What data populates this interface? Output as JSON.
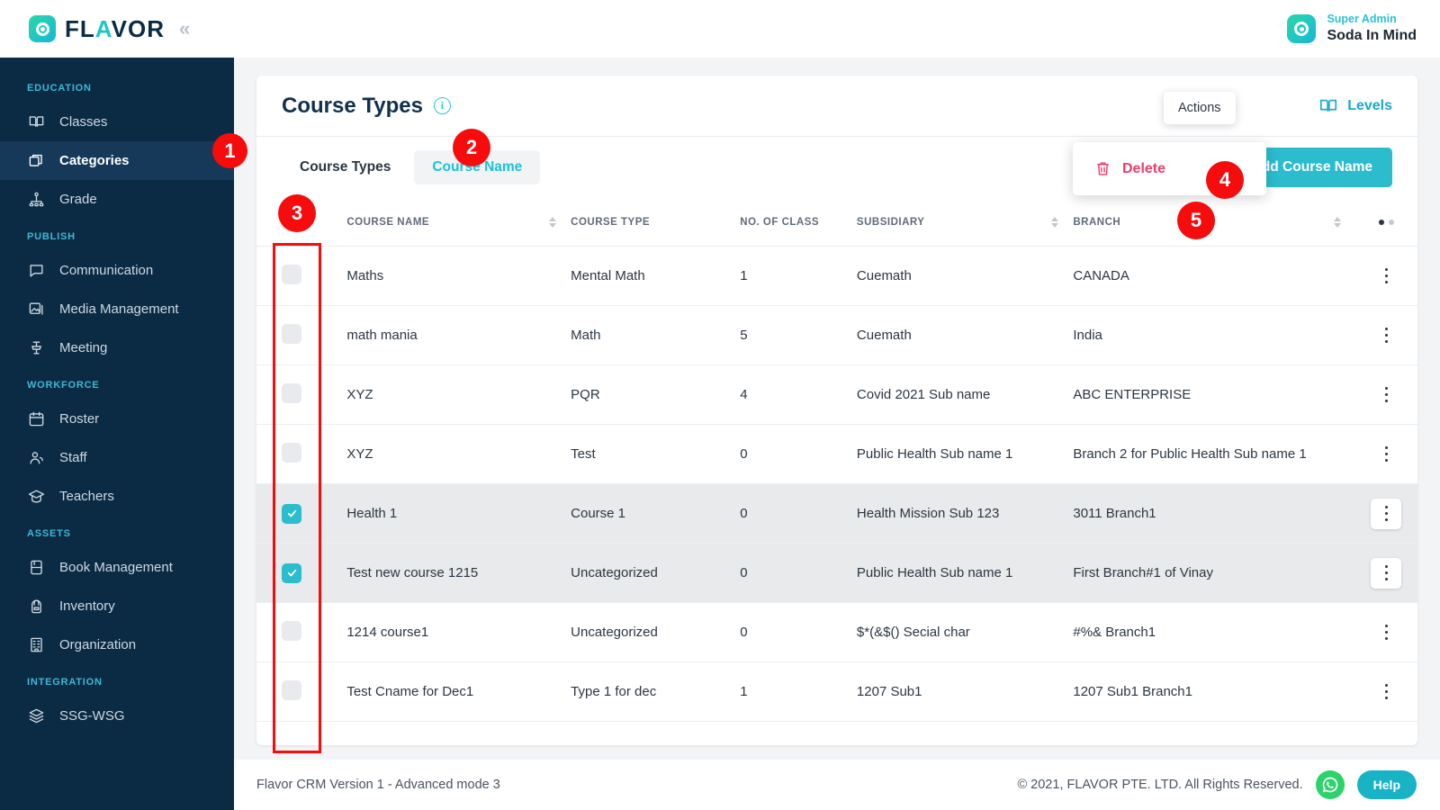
{
  "brand": {
    "name": "FLAVOR",
    "collapse_icon": "chevrons-left-icon",
    "accent": "#2bbccd",
    "sidebar_bg": "#0b2b45"
  },
  "topbar": {
    "user_role": "Super Admin",
    "user_name": "Soda In Mind"
  },
  "sidebar": {
    "groups": [
      {
        "label": "EDUCATION",
        "items": [
          {
            "label": "Classes",
            "icon": "book-open-icon",
            "active": false
          },
          {
            "label": "Categories",
            "icon": "layers-stack-icon",
            "active": true
          },
          {
            "label": "Grade",
            "icon": "hierarchy-icon",
            "active": false
          }
        ]
      },
      {
        "label": "PUBLISH",
        "items": [
          {
            "label": "Communication",
            "icon": "chat-bubble-icon",
            "active": false
          },
          {
            "label": "Media Management",
            "icon": "image-icon",
            "active": false
          },
          {
            "label": "Meeting",
            "icon": "podium-icon",
            "active": false
          }
        ]
      },
      {
        "label": "WORKFORCE",
        "items": [
          {
            "label": "Roster",
            "icon": "calendar-icon",
            "active": false
          },
          {
            "label": "Staff",
            "icon": "users-icon",
            "active": false
          },
          {
            "label": "Teachers",
            "icon": "graduation-cap-icon",
            "active": false
          }
        ]
      },
      {
        "label": "ASSETS",
        "items": [
          {
            "label": "Book Management",
            "icon": "book-icon",
            "active": false
          },
          {
            "label": "Inventory",
            "icon": "backpack-icon",
            "active": false
          },
          {
            "label": "Organization",
            "icon": "building-icon",
            "active": false
          }
        ]
      },
      {
        "label": "INTEGRATION",
        "items": [
          {
            "label": "SSG-WSG",
            "icon": "layers-icon",
            "active": false
          }
        ]
      }
    ]
  },
  "page": {
    "title": "Course Types",
    "info_icon": "info-icon",
    "levels_label": "Levels",
    "levels_icon": "book-open-icon"
  },
  "toolbar": {
    "tabs": [
      {
        "label": "Course Types",
        "active": false
      },
      {
        "label": "Course Name",
        "active": true
      }
    ],
    "search_icon": "search-icon",
    "export_icon": "file-plus-icon",
    "actions_icon": "kebab-menu-icon",
    "add_button_label": "Add Course Name"
  },
  "overlays": {
    "tooltip_actions": "Actions",
    "menu_delete": "Delete",
    "menu_delete_icon": "trash-icon",
    "badges": [
      "1",
      "2",
      "3",
      "4",
      "5"
    ]
  },
  "table": {
    "columns": [
      {
        "key": "check",
        "label": "",
        "sortable": false
      },
      {
        "key": "name",
        "label": "COURSE NAME",
        "sortable": true
      },
      {
        "key": "type",
        "label": "COURSE TYPE",
        "sortable": false
      },
      {
        "key": "classes",
        "label": "NO. OF CLASS",
        "sortable": false
      },
      {
        "key": "sub",
        "label": "SUBSIDIARY",
        "sortable": true
      },
      {
        "key": "branch",
        "label": "BRANCH",
        "sortable": true
      },
      {
        "key": "actions",
        "label": "",
        "sortable": false
      }
    ],
    "rows": [
      {
        "selected": false,
        "name": "Maths",
        "type": "Mental Math",
        "classes": "1",
        "sub": "Cuemath",
        "branch": "CANADA"
      },
      {
        "selected": false,
        "name": "math mania",
        "type": "Math",
        "classes": "5",
        "sub": "Cuemath",
        "branch": "India"
      },
      {
        "selected": false,
        "name": "XYZ",
        "type": "PQR",
        "classes": "4",
        "sub": "Covid 2021 Sub name",
        "branch": "ABC ENTERPRISE"
      },
      {
        "selected": false,
        "name": "XYZ",
        "type": "Test",
        "classes": "0",
        "sub": "Public Health Sub name 1",
        "branch": "Branch 2 for Public Health Sub name 1"
      },
      {
        "selected": true,
        "name": "Health 1",
        "type": "Course 1",
        "classes": "0",
        "sub": "Health Mission Sub 123",
        "branch": "3011 Branch1"
      },
      {
        "selected": true,
        "name": "Test new course 1215",
        "type": "Uncategorized",
        "classes": "0",
        "sub": "Public Health Sub name 1",
        "branch": "First Branch#1 of Vinay"
      },
      {
        "selected": false,
        "name": "1214 course1",
        "type": "Uncategorized",
        "classes": "0",
        "sub": "$*(&$() Secial char",
        "branch": "#%& Branch1"
      },
      {
        "selected": false,
        "name": "Test Cname for Dec1",
        "type": "Type 1 for dec",
        "classes": "1",
        "sub": "1207 Sub1",
        "branch": "1207 Sub1 Branch1"
      }
    ]
  },
  "footer": {
    "version": "Flavor CRM Version 1 - Advanced mode 3",
    "copyright": "© 2021, FLAVOR PTE. LTD. All Rights Reserved.",
    "whatsapp_icon": "whatsapp-icon",
    "help_label": "Help"
  }
}
